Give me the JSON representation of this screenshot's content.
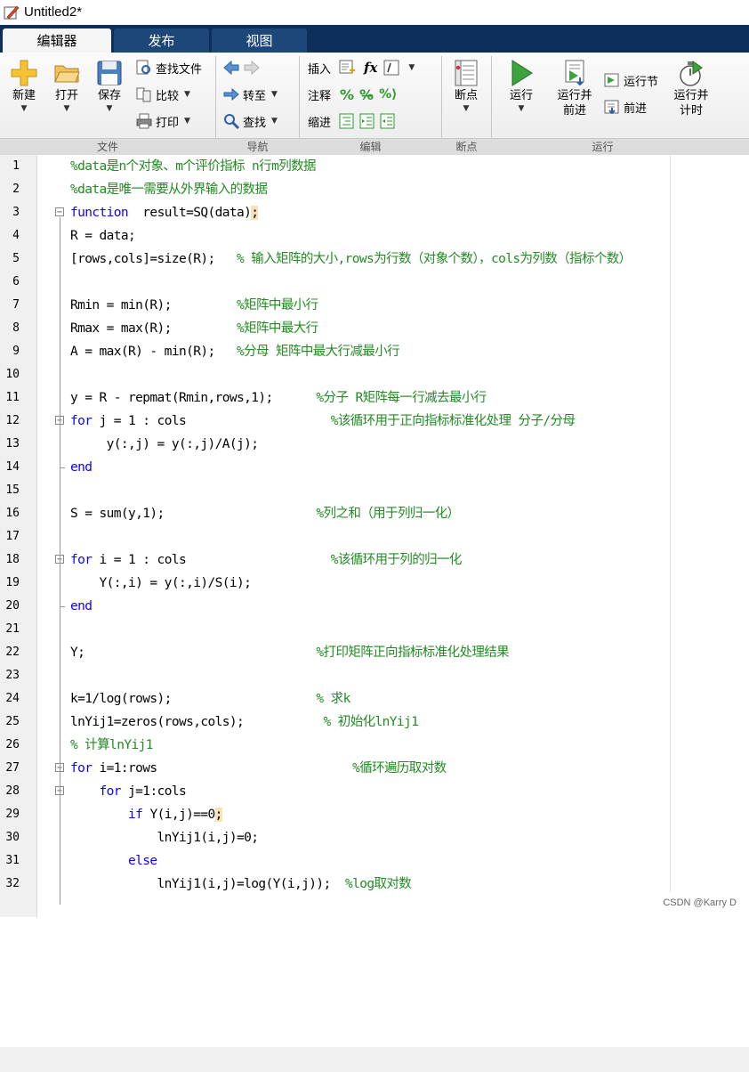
{
  "window": {
    "title": "Untitled2*"
  },
  "tabs": [
    {
      "label": "编辑器",
      "active": true
    },
    {
      "label": "发布",
      "active": false
    },
    {
      "label": "视图",
      "active": false
    }
  ],
  "ribbon": {
    "file": {
      "group_label": "文件",
      "new_label": "新建",
      "open_label": "打开",
      "save_label": "保存",
      "find_file_label": "查找文件",
      "compare_label": "比较",
      "print_label": "打印"
    },
    "navigate": {
      "group_label": "导航",
      "goto_label": "转至",
      "find_label": "查找"
    },
    "edit": {
      "group_label": "编辑",
      "insert_label": "插入",
      "comment_label": "注释",
      "indent_label": "缩进"
    },
    "breakpoints": {
      "group_label": "断点",
      "breakpoints_label": "断点"
    },
    "run": {
      "group_label": "运行",
      "run_label": "运行",
      "run_advance_label": "运行并\n前进",
      "run_section_label": "运行节",
      "advance_label": "前进",
      "run_time_label": "运行并\n计时"
    }
  },
  "editor": {
    "lines": [
      {
        "n": "1",
        "indent": 0,
        "parts": [
          {
            "t": "%data是n个对象、m个评价指标 n行m列数据",
            "c": "cm"
          }
        ],
        "fold": ""
      },
      {
        "n": "2",
        "indent": 0,
        "parts": [
          {
            "t": "%data是唯一需要从外界输入的数据",
            "c": "cm"
          }
        ],
        "fold": ""
      },
      {
        "n": "3",
        "indent": 0,
        "parts": [
          {
            "t": "function",
            "c": "kw"
          },
          {
            "t": "  result=SQ(data)",
            "c": ""
          },
          {
            "t": ";",
            "c": "hl"
          }
        ],
        "fold": "open"
      },
      {
        "n": "4",
        "indent": 0,
        "parts": [
          {
            "t": "R = data;",
            "c": ""
          }
        ],
        "fold": ""
      },
      {
        "n": "5",
        "indent": 0,
        "parts": [
          {
            "t": "[rows,cols]=size(R);   ",
            "c": ""
          },
          {
            "t": "% 输入矩阵的大小,rows为行数（对象个数），cols为列数（指标个数）",
            "c": "cm"
          }
        ],
        "fold": ""
      },
      {
        "n": "6",
        "indent": 0,
        "parts": [],
        "fold": ""
      },
      {
        "n": "7",
        "indent": 0,
        "parts": [
          {
            "t": "Rmin = min(R);         ",
            "c": ""
          },
          {
            "t": "%矩阵中最小行",
            "c": "cm"
          }
        ],
        "fold": ""
      },
      {
        "n": "8",
        "indent": 0,
        "parts": [
          {
            "t": "Rmax = max(R);         ",
            "c": ""
          },
          {
            "t": "%矩阵中最大行",
            "c": "cm"
          }
        ],
        "fold": ""
      },
      {
        "n": "9",
        "indent": 0,
        "parts": [
          {
            "t": "A = max(R) - min(R);   ",
            "c": ""
          },
          {
            "t": "%分母 矩阵中最大行减最小行",
            "c": "cm"
          }
        ],
        "fold": ""
      },
      {
        "n": "10",
        "indent": 0,
        "parts": [],
        "fold": ""
      },
      {
        "n": "11",
        "indent": 0,
        "parts": [
          {
            "t": "y = R - repmat(Rmin,rows,1);      ",
            "c": ""
          },
          {
            "t": "%分子 R矩阵每一行减去最小行",
            "c": "cm"
          }
        ],
        "fold": ""
      },
      {
        "n": "12",
        "indent": 0,
        "parts": [
          {
            "t": "for",
            "c": "kw"
          },
          {
            "t": " j = 1 : cols                    ",
            "c": ""
          },
          {
            "t": "%该循环用于正向指标标准化处理 分子/分母",
            "c": "cm"
          }
        ],
        "fold": "open"
      },
      {
        "n": "13",
        "indent": 0,
        "parts": [
          {
            "t": "     y(:,j) = y(:,j)/A(j);",
            "c": ""
          }
        ],
        "fold": ""
      },
      {
        "n": "14",
        "indent": 0,
        "parts": [
          {
            "t": "end",
            "c": "kw"
          }
        ],
        "fold": "end"
      },
      {
        "n": "15",
        "indent": 0,
        "parts": [],
        "fold": ""
      },
      {
        "n": "16",
        "indent": 0,
        "parts": [
          {
            "t": "S = sum(y,1);                     ",
            "c": ""
          },
          {
            "t": "%列之和（用于列归一化）",
            "c": "cm"
          }
        ],
        "fold": ""
      },
      {
        "n": "17",
        "indent": 0,
        "parts": [],
        "fold": ""
      },
      {
        "n": "18",
        "indent": 0,
        "parts": [
          {
            "t": "for",
            "c": "kw"
          },
          {
            "t": " i = 1 : cols                    ",
            "c": ""
          },
          {
            "t": "%该循环用于列的归一化",
            "c": "cm"
          }
        ],
        "fold": "open"
      },
      {
        "n": "19",
        "indent": 0,
        "parts": [
          {
            "t": "    Y(:,i) = y(:,i)/S(i);",
            "c": ""
          }
        ],
        "fold": ""
      },
      {
        "n": "20",
        "indent": 0,
        "parts": [
          {
            "t": "end",
            "c": "kw"
          }
        ],
        "fold": "end"
      },
      {
        "n": "21",
        "indent": 0,
        "parts": [],
        "fold": ""
      },
      {
        "n": "22",
        "indent": 0,
        "parts": [
          {
            "t": "Y;                                ",
            "c": ""
          },
          {
            "t": "%打印矩阵正向指标标准化处理结果",
            "c": "cm"
          }
        ],
        "fold": ""
      },
      {
        "n": "23",
        "indent": 0,
        "parts": [],
        "fold": ""
      },
      {
        "n": "24",
        "indent": 0,
        "parts": [
          {
            "t": "k=1/log(rows);                    ",
            "c": ""
          },
          {
            "t": "% 求k",
            "c": "cm"
          }
        ],
        "fold": ""
      },
      {
        "n": "25",
        "indent": 0,
        "parts": [
          {
            "t": "lnYij1=zeros(rows,cols);           ",
            "c": ""
          },
          {
            "t": "% 初始化lnYij1",
            "c": "cm"
          }
        ],
        "fold": ""
      },
      {
        "n": "26",
        "indent": 0,
        "parts": [
          {
            "t": "% 计算lnYij1",
            "c": "cm"
          }
        ],
        "fold": ""
      },
      {
        "n": "27",
        "indent": 0,
        "parts": [
          {
            "t": "for",
            "c": "kw"
          },
          {
            "t": " i=1:rows                           ",
            "c": ""
          },
          {
            "t": "%循环遍历取对数",
            "c": "cm"
          }
        ],
        "fold": "open"
      },
      {
        "n": "28",
        "indent": 0,
        "parts": [
          {
            "t": "    ",
            "c": ""
          },
          {
            "t": "for",
            "c": "kw"
          },
          {
            "t": " j=1:cols",
            "c": ""
          }
        ],
        "fold": "open2"
      },
      {
        "n": "29",
        "indent": 0,
        "parts": [
          {
            "t": "        ",
            "c": ""
          },
          {
            "t": "if",
            "c": "kw"
          },
          {
            "t": " Y(i,j)==0",
            "c": ""
          },
          {
            "t": ";",
            "c": "hl"
          }
        ],
        "fold": ""
      },
      {
        "n": "30",
        "indent": 0,
        "parts": [
          {
            "t": "            lnYij1(i,j)=0;",
            "c": ""
          }
        ],
        "fold": ""
      },
      {
        "n": "31",
        "indent": 0,
        "parts": [
          {
            "t": "        ",
            "c": ""
          },
          {
            "t": "else",
            "c": "kw"
          }
        ],
        "fold": ""
      },
      {
        "n": "32",
        "indent": 0,
        "parts": [
          {
            "t": "            lnYij1(i,j)=log(Y(i,j));  ",
            "c": ""
          },
          {
            "t": "%log取对数",
            "c": "cm"
          }
        ],
        "fold": ""
      }
    ]
  },
  "watermark": "CSDN @Karry D",
  "colors": {
    "keyword": "#0e00ff",
    "comment": "#228b22",
    "tab_bar": "#0e2f5a"
  }
}
